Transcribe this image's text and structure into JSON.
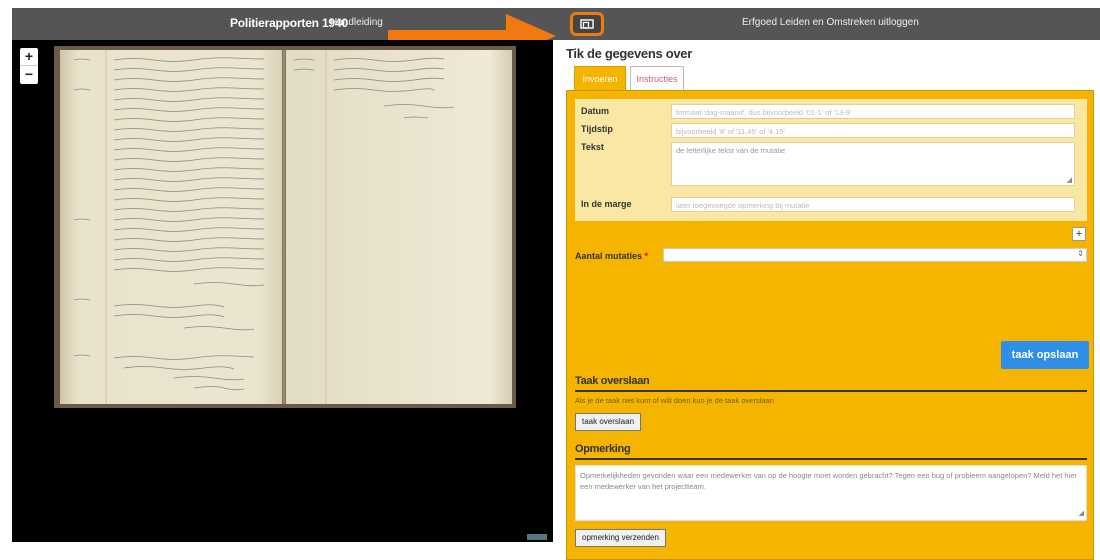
{
  "topbar": {
    "title": "Politierapporten 1940",
    "manual_link": "Handleiding",
    "logout_link": "Erfgoed Leiden en Omstreken uitloggen",
    "fullscreen_icon": "fullscreen-icon",
    "accent": "#f07a10"
  },
  "viewer": {
    "zoom_in": "+",
    "zoom_out": "−"
  },
  "panel": {
    "heading": "Tik de gegevens over",
    "tabs": [
      "Invoeren",
      "Instructies"
    ],
    "fields": {
      "datum_label": "Datum",
      "datum_placeholder": "formaat 'dag-maand', dus bijvoorbeeld '01-1' of '13-9'",
      "tijdstip_label": "Tijdstip",
      "tijdstip_placeholder": "bijvoorbeeld '8' of '11.45' of '4.15'",
      "tekst_label": "Tekst",
      "tekst_placeholder": "de letterlijke tekst van de mutatie",
      "marge_label": "In de marge",
      "marge_placeholder": "later toegevoegde opmerking bij mutatie"
    },
    "add_button": "+",
    "mutaties_label": "Aantal mutaties",
    "required_mark": "*",
    "save_button": "taak opslaan",
    "skip_heading": "Taak overslaan",
    "skip_text": "Als je de taak niet kunt of wilt doen kun je de taak overslaan",
    "skip_button": "taak overslaan",
    "remark_heading": "Opmerking",
    "remark_placeholder": "Opmerkelijkheden gevonden waar een medewerker van op de hoogte moet worden gebracht? Tegen een bug of probleem aangelopen? Meld het hier een medewerker van het projectteam.",
    "remark_button": "opmerking verzenden",
    "colors": {
      "form_bg": "#f5b400",
      "save_bg": "#2f8ee8"
    }
  }
}
